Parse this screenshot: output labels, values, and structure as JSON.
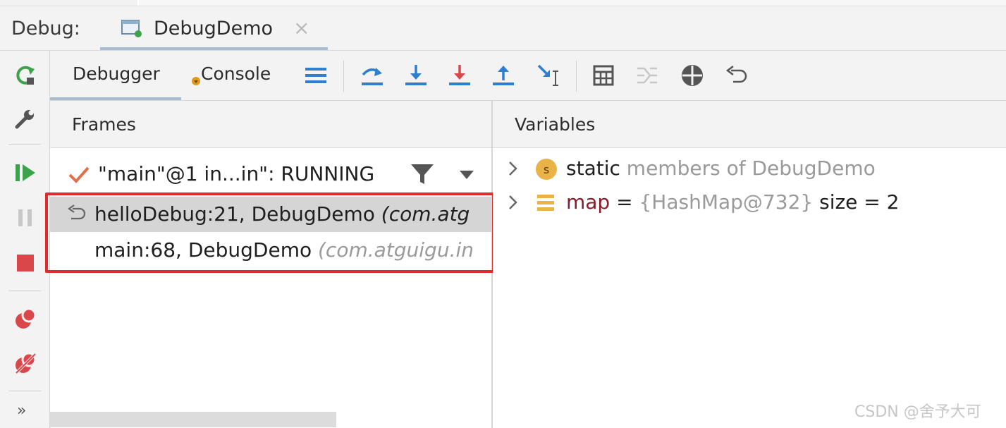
{
  "header": {
    "label": "Debug:",
    "tab_title": "DebugDemo",
    "tab_close": "×"
  },
  "toolbar": {
    "tab_debugger": "Debugger",
    "tab_console": "Console"
  },
  "frames": {
    "title": "Frames",
    "thread": "\"main\"@1 in...in\": RUNNING",
    "items": [
      {
        "name": "helloDebug:21, DebugDemo ",
        "pkg": "(com.atg",
        "selected": true
      },
      {
        "name": "main:68, DebugDemo ",
        "pkg": "(com.atguigu.in",
        "selected": false
      }
    ]
  },
  "variables": {
    "title": "Variables",
    "rows": [
      {
        "kw": "static",
        "rest": " members of DebugDemo",
        "icon": "static-icon"
      },
      {
        "name": "map",
        "eq": " = ",
        "value": "{HashMap@732}",
        "size": "  size = 2",
        "icon": "field-icon"
      }
    ]
  },
  "leftbar": {
    "more": "»"
  },
  "watermark": "CSDN @舍予大可",
  "colors": {
    "accent_tab": "#a9bccd",
    "green": "#3da34a",
    "red": "#d9474b",
    "blue": "#2e7fcf",
    "highlight": "#e02b2b",
    "map_name": "#8b1a2b"
  }
}
